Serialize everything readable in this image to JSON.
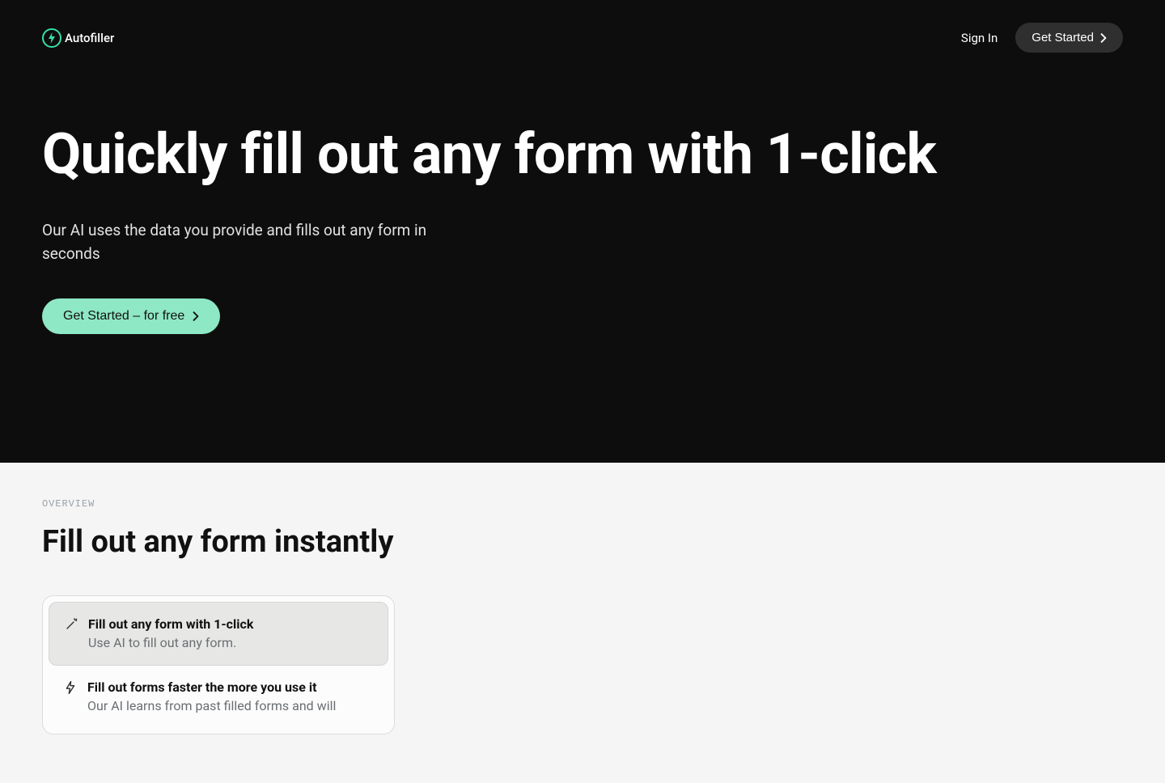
{
  "nav": {
    "brand": "Autofiller",
    "signIn": "Sign In",
    "getStarted": "Get Started"
  },
  "hero": {
    "title": "Quickly fill out any form with 1-click",
    "subtitle": "Our AI uses the data you provide and fills out any form in seconds",
    "cta": "Get Started – for free"
  },
  "overview": {
    "label": "OVERVIEW",
    "heading": "Fill out any form instantly",
    "features": [
      {
        "title": "Fill out any form with 1-click",
        "desc": "Use AI to fill out any form.",
        "active": true
      },
      {
        "title": "Fill out forms faster the more you use it",
        "desc": "Our AI learns from past filled forms and will",
        "active": false
      }
    ]
  }
}
